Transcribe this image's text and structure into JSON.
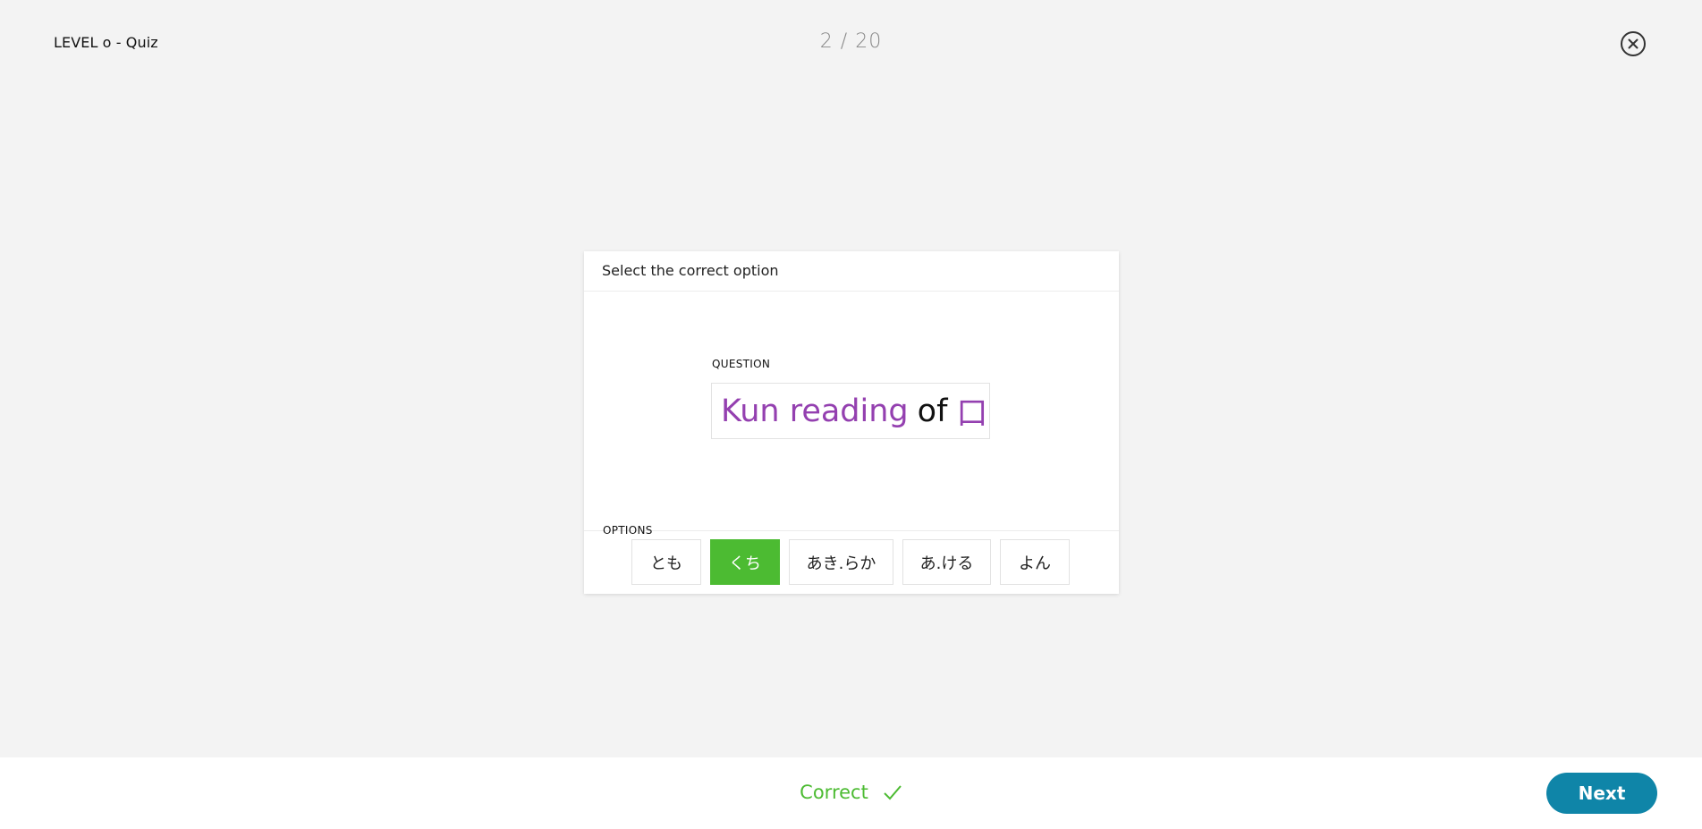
{
  "header": {
    "title": "LEVEL o - Quiz",
    "progress": "2 / 20",
    "close_icon": "close-circle-icon"
  },
  "card": {
    "instruction": "Select the correct option",
    "question_label": "QUESTION",
    "question": {
      "part1": "Kun reading",
      "part2": "of",
      "kanji": "口"
    },
    "options_label": "OPTIONS",
    "options": [
      {
        "label": "とも",
        "selected": false
      },
      {
        "label": "くち",
        "selected": true
      },
      {
        "label": "あき.らか",
        "selected": false
      },
      {
        "label": "あ.ける",
        "selected": false
      },
      {
        "label": "よん",
        "selected": false
      }
    ]
  },
  "footer": {
    "result": "Correct",
    "result_icon": "checkmark-icon",
    "next_label": "Next"
  },
  "colors": {
    "accent_purple": "#9440b0",
    "correct_green": "#4cbb32",
    "next_blue": "#0f85a8",
    "background": "#f3f3f3"
  }
}
